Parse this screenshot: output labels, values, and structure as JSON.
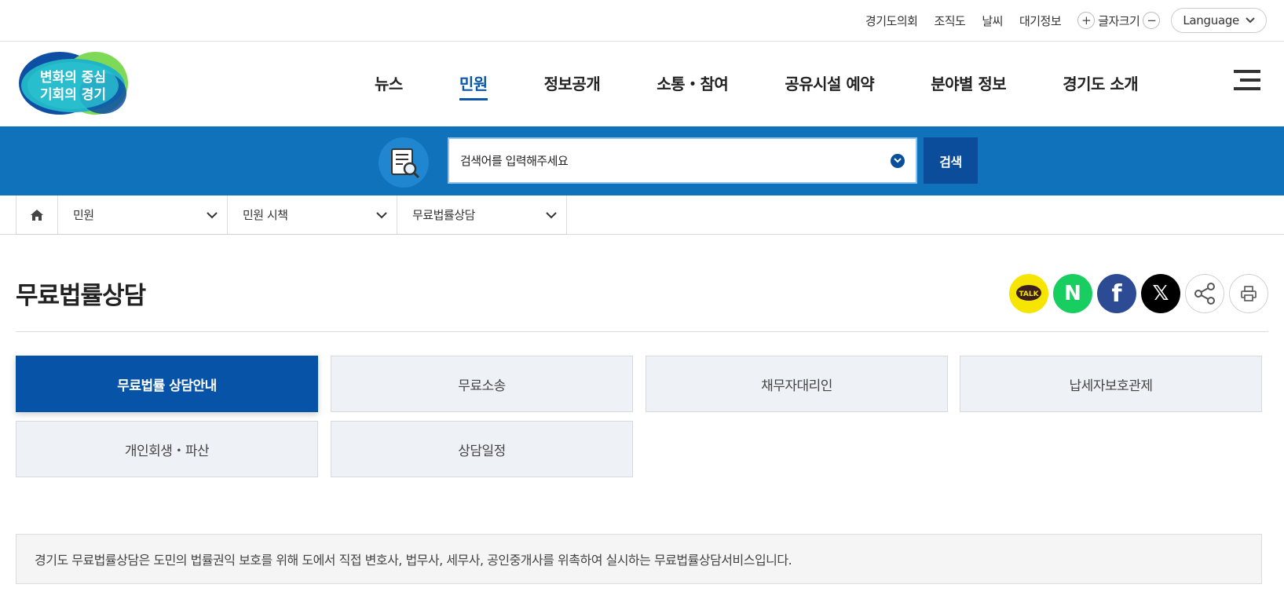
{
  "utility": {
    "links": [
      "경기도의회",
      "조직도",
      "날씨",
      "대기정보"
    ],
    "font_size_label": "글자크기",
    "font_plus": "+",
    "font_minus": "−",
    "language_label": "Language"
  },
  "logo": {
    "line1": "변화의 중심",
    "line2": "기회의 경기"
  },
  "gnb": {
    "items": [
      "뉴스",
      "민원",
      "정보공개",
      "소통・참여",
      "공유시설 예약",
      "분야별 정보",
      "경기도 소개"
    ],
    "active": "민원"
  },
  "search": {
    "placeholder": "검색어를 입력해주세요",
    "button_label": "검색"
  },
  "breadcrumb": {
    "items": [
      "민원",
      "민원 시책",
      "무료법률상담"
    ]
  },
  "page": {
    "title": "무료법률상담"
  },
  "share": {
    "kakao_label": "TALK",
    "naver_label": "N",
    "facebook_label": "f",
    "x_label": "𝕏"
  },
  "tabs": {
    "items": [
      "무료법률 상담안내",
      "무료소송",
      "채무자대리인",
      "납세자보호관제",
      "개인회생・파산",
      "상담일정"
    ],
    "active": "무료법률 상담안내"
  },
  "notice": {
    "text": "경기도 무료법률상담은 도민의 법률권익 보호를 위해 도에서 직접 변호사, 법무사, 세무사, 공인중개사를 위촉하여 실시하는 무료법률상담서비스입니다."
  },
  "colors": {
    "primary": "#0653a8",
    "search_band": "#0f72bb",
    "kakao": "#f6e500",
    "naver": "#19ce60",
    "facebook": "#2d4b95"
  }
}
